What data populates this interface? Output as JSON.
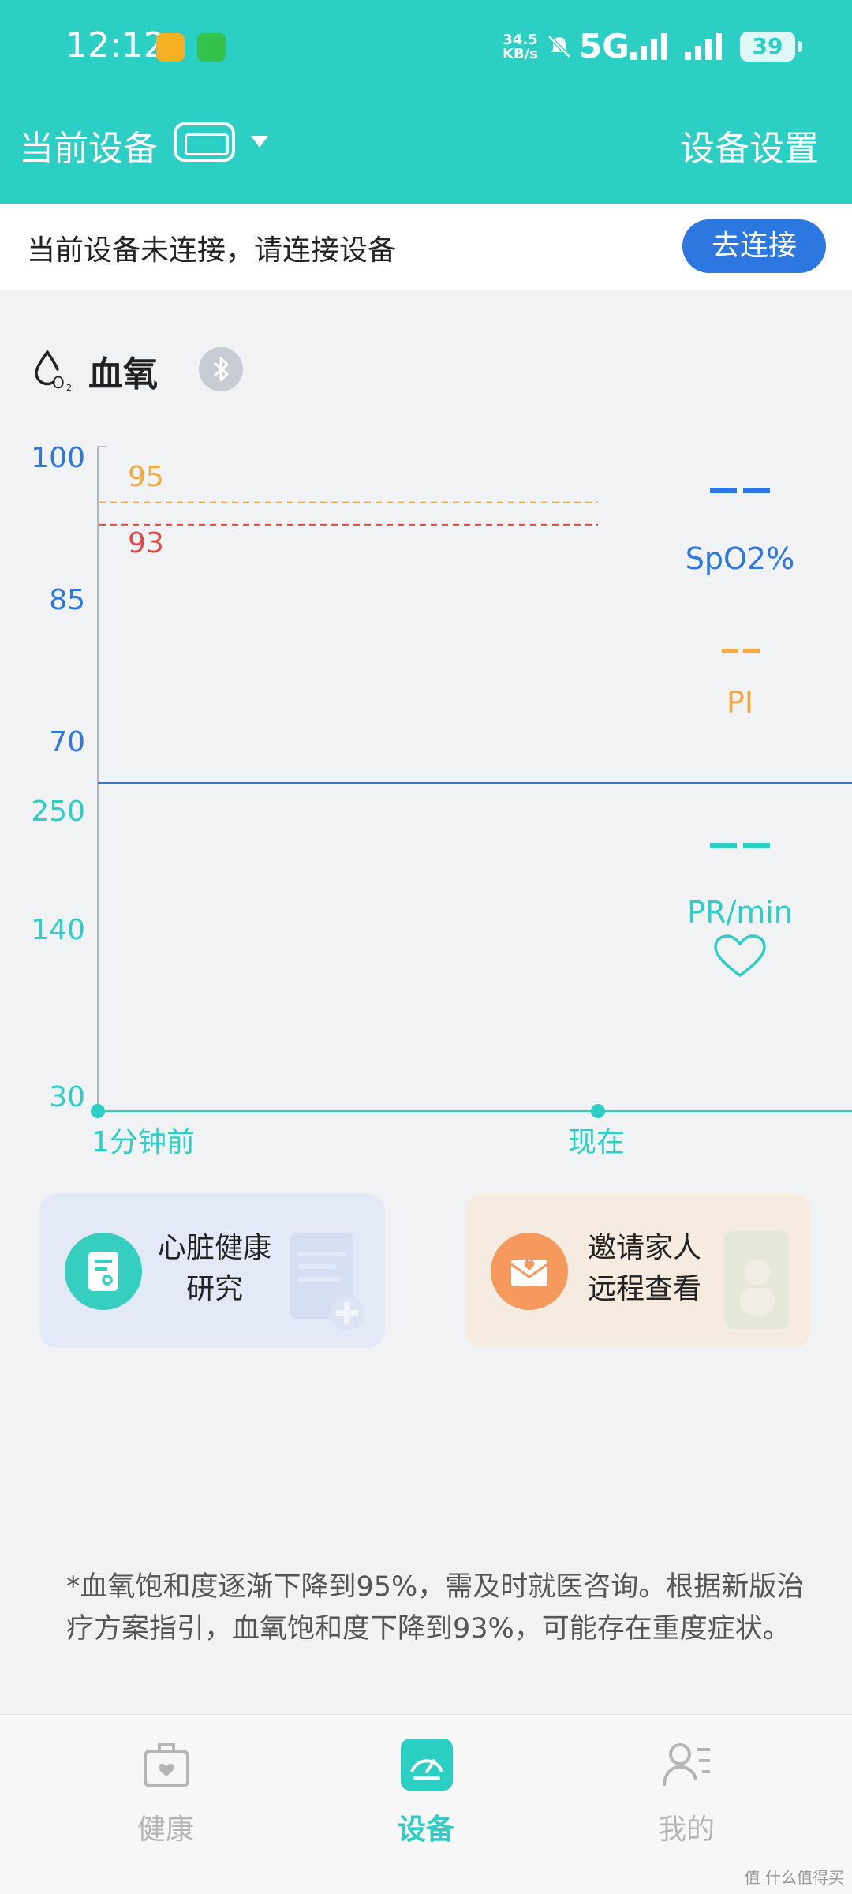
{
  "status_bar": {
    "time": "12:12",
    "net_speed_value": "34.5",
    "net_speed_unit": "KB/s",
    "network": "5G",
    "battery": "39"
  },
  "header": {
    "title": "当前设备",
    "settings_label": "设备设置"
  },
  "banner": {
    "message": "当前设备未连接，请连接设备",
    "button_label": "去连接"
  },
  "chart_header": {
    "title": "血氧"
  },
  "colors": {
    "primary": "#2ccfc3",
    "blue": "#2c78e0",
    "orange": "#f2a941",
    "red": "#e04848"
  },
  "chart_data": {
    "type": "line",
    "spo2_axis": {
      "ticks": [
        "100",
        "85",
        "70"
      ],
      "ylim": [
        70,
        100
      ]
    },
    "pr_axis": {
      "ticks": [
        "250",
        "140",
        "30"
      ],
      "ylim": [
        30,
        250
      ]
    },
    "x_ticks": [
      "1分钟前",
      "现在"
    ],
    "thresholds": [
      {
        "label": "95",
        "value": 95,
        "color": "#f2a941"
      },
      {
        "label": "93",
        "value": 93,
        "color": "#e04848"
      }
    ],
    "legend": [
      {
        "name": "SpO2%",
        "value": "--",
        "color": "#2c78e0"
      },
      {
        "name": "PI",
        "value": "--",
        "color": "#f2a941"
      },
      {
        "name": "PR/min",
        "value": "--",
        "color": "#2ccfc3"
      }
    ],
    "series": []
  },
  "cards": [
    {
      "line1": "心脏健康",
      "line2": "研究"
    },
    {
      "line1": "邀请家人",
      "line2": "远程查看"
    }
  ],
  "footnote": "*血氧饱和度逐渐下降到95%，需及时就医咨询。根据新版治疗方案指引，血氧饱和度下降到93%，可能存在重度症状。",
  "nav": [
    {
      "label": "健康",
      "icon": "medical-kit-icon",
      "active": false
    },
    {
      "label": "设备",
      "icon": "gauge-icon",
      "active": true
    },
    {
      "label": "我的",
      "icon": "profile-icon",
      "active": false
    }
  ],
  "watermark": "值 什么值得买"
}
